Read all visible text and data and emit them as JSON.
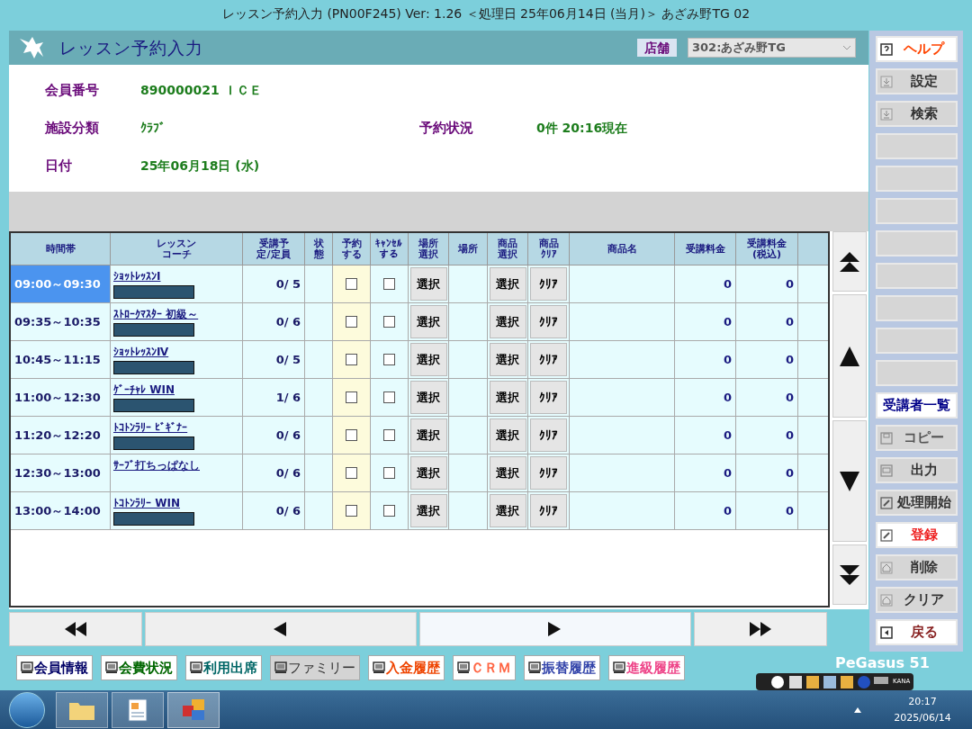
{
  "window": {
    "title": "レッスン予約入力 (PN00F245) Ver: 1.26 ＜処理日 25年06月14日 (当月)＞ あざみ野TG 02"
  },
  "header": {
    "title": "レッスン予約入力",
    "store_label": "店舗",
    "store_value": "302:あざみ野TG"
  },
  "info": [
    {
      "label": "会員番号",
      "value": "890000021 ＩＣＥ"
    },
    {
      "label": "施設分類",
      "value": "ｸﾗﾌﾞ",
      "label2": "予約状況",
      "value2": "0件 20:16現在"
    },
    {
      "label": "日付",
      "value": "25年06月18日 (水)"
    }
  ],
  "table": {
    "columns": [
      "時間帯",
      "レッスンコーチ",
      "受講予定/定員",
      "状態",
      "予約する",
      "ｷｬﾝｾﾙする",
      "場所選択",
      "場所",
      "商品選択",
      "商品ｸﾘｱ",
      "商品名",
      "受講料金",
      "受講料金(税込)"
    ],
    "rows": [
      {
        "time": "09:00～09:30",
        "lesson": "ｼｮｯﾄﾚｯｽﾝⅠ",
        "coach_redacted": true,
        "count": "0/ 5",
        "reserve": false,
        "cancel": false,
        "place": "選択",
        "product": "選択",
        "clear": "ｸﾘｱ",
        "fee": "0",
        "fee_tax": "0",
        "selected": true
      },
      {
        "time": "09:35～10:35",
        "lesson": "ｽﾄﾛｰｸﾏｽﾀｰ 初級～",
        "coach_redacted": true,
        "count": "0/ 6",
        "reserve": false,
        "cancel": false,
        "place": "選択",
        "product": "選択",
        "clear": "ｸﾘｱ",
        "fee": "0",
        "fee_tax": "0",
        "selected": false
      },
      {
        "time": "10:45～11:15",
        "lesson": "ｼｮｯﾄﾚｯｽﾝⅣ",
        "coach_redacted": true,
        "count": "0/ 5",
        "reserve": false,
        "cancel": false,
        "place": "選択",
        "product": "選択",
        "clear": "ｸﾘｱ",
        "fee": "0",
        "fee_tax": "0",
        "selected": false
      },
      {
        "time": "11:00～12:30",
        "lesson": "ｹﾞｰﾁｬﾚ WIN",
        "coach_redacted": true,
        "count": "1/ 6",
        "reserve": false,
        "cancel": false,
        "place": "選択",
        "product": "選択",
        "clear": "ｸﾘｱ",
        "fee": "0",
        "fee_tax": "0",
        "selected": false
      },
      {
        "time": "11:20～12:20",
        "lesson": "ﾄｺﾄﾝﾗﾘｰ ﾋﾞｷﾞﾅｰ",
        "coach_redacted": true,
        "count": "0/ 6",
        "reserve": false,
        "cancel": false,
        "place": "選択",
        "product": "選択",
        "clear": "ｸﾘｱ",
        "fee": "0",
        "fee_tax": "0",
        "selected": false
      },
      {
        "time": "12:30～13:00",
        "lesson": "ｻｰﾌﾞ打ちっぱなし",
        "coach_redacted": false,
        "count": "0/ 6",
        "reserve": false,
        "cancel": false,
        "place": "選択",
        "product": "選択",
        "clear": "ｸﾘｱ",
        "fee": "0",
        "fee_tax": "0",
        "selected": false
      },
      {
        "time": "13:00～14:00",
        "lesson": "ﾄｺﾄﾝﾗﾘｰ WIN",
        "coach_redacted": true,
        "count": "0/ 6",
        "reserve": false,
        "cancel": false,
        "place": "選択",
        "product": "選択",
        "clear": "ｸﾘｱ",
        "fee": "0",
        "fee_tax": "0",
        "selected": false
      }
    ]
  },
  "side_buttons": [
    {
      "label": "ヘルプ",
      "kind": "help",
      "enabled": true,
      "color": "#ff4400"
    },
    {
      "label": "設定",
      "kind": "download",
      "enabled": false,
      "color": "#333333"
    },
    {
      "label": "検索",
      "kind": "download",
      "enabled": false,
      "color": "#333333"
    },
    {
      "kind": "blank",
      "enabled": false
    },
    {
      "kind": "blank",
      "enabled": false
    },
    {
      "kind": "blank",
      "enabled": false
    },
    {
      "kind": "blank",
      "enabled": false
    },
    {
      "kind": "blank",
      "enabled": false
    },
    {
      "kind": "blank",
      "enabled": false
    },
    {
      "kind": "blank",
      "enabled": false
    },
    {
      "kind": "blank",
      "enabled": false
    },
    {
      "label": "受講者一覧",
      "kind": "text",
      "enabled": true,
      "color": "#000088"
    },
    {
      "label": "コピー",
      "kind": "save",
      "enabled": false,
      "color": "#555555"
    },
    {
      "label": "出力",
      "kind": "screen",
      "enabled": false,
      "color": "#333333"
    },
    {
      "label": "処理開始",
      "kind": "pencil",
      "enabled": false,
      "color": "#333333"
    },
    {
      "label": "登録",
      "kind": "pencil",
      "enabled": true,
      "color": "#ee2222"
    },
    {
      "label": "削除",
      "kind": "house",
      "enabled": false,
      "color": "#333333"
    },
    {
      "label": "クリア",
      "kind": "house",
      "enabled": false,
      "color": "#333333"
    },
    {
      "label": "戻る",
      "kind": "back",
      "enabled": true,
      "color": "#882222"
    }
  ],
  "bottom_buttons": [
    {
      "label": "会員情報",
      "enabled": true,
      "color": "#000066"
    },
    {
      "label": "会費状況",
      "enabled": true,
      "color": "#006600"
    },
    {
      "label": "利用出席",
      "enabled": true,
      "color": "#006666"
    },
    {
      "label": "ファミリー",
      "enabled": false,
      "color": "#333333"
    },
    {
      "label": "入金履歴",
      "enabled": true,
      "color": "#ee4400"
    },
    {
      "label": "ＣＲＭ",
      "enabled": true,
      "color": "#ff6644"
    },
    {
      "label": "振替履歴",
      "enabled": true,
      "color": "#3344aa"
    },
    {
      "label": "進級履歴",
      "enabled": true,
      "color": "#ee4488"
    }
  ],
  "brand": "PeGasus 51",
  "ime_bar": {
    "mode": "KANA"
  },
  "taskbar": {
    "time": "20:17",
    "date": "2025/06/14"
  }
}
